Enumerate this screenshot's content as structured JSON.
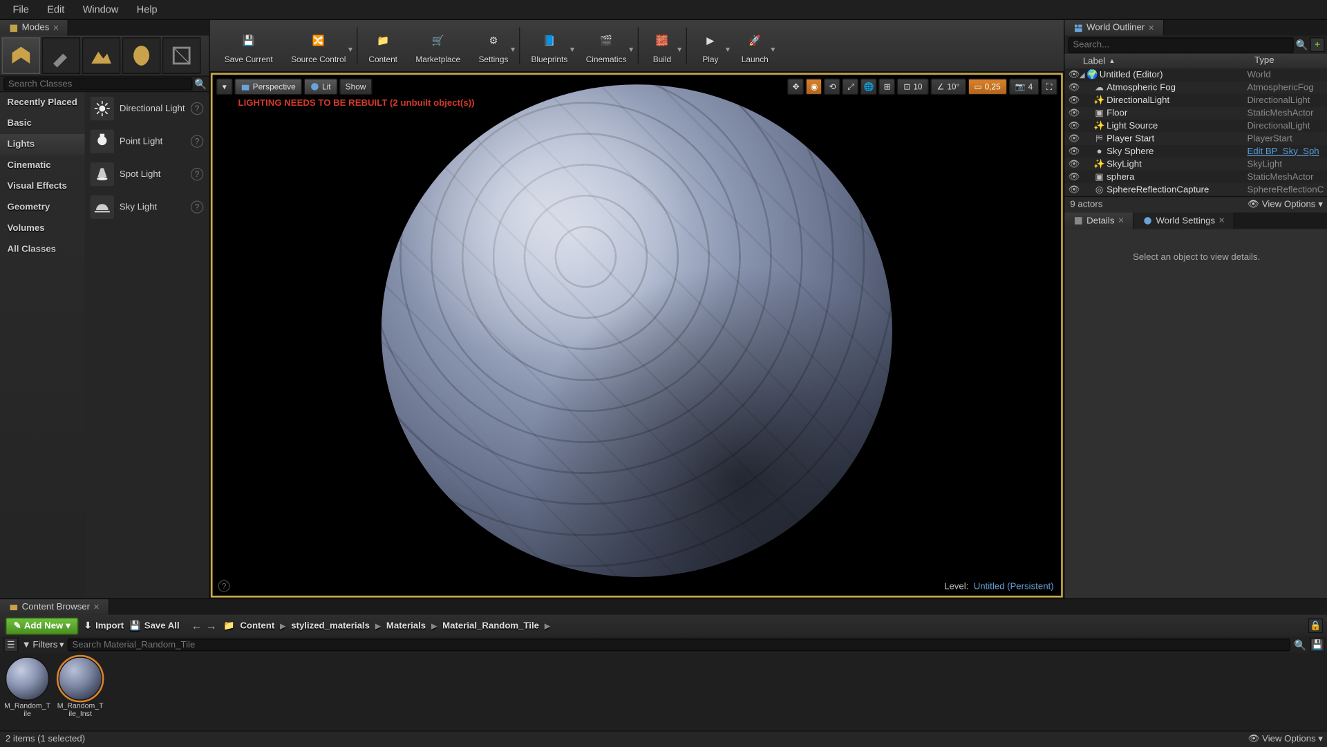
{
  "menu": {
    "file": "File",
    "edit": "Edit",
    "window": "Window",
    "help": "Help"
  },
  "modes_tab": "Modes",
  "searchClassesPlaceholder": "Search Classes",
  "categories": [
    "Recently Placed",
    "Basic",
    "Lights",
    "Cinematic",
    "Visual Effects",
    "Geometry",
    "Volumes",
    "All Classes"
  ],
  "activeCategory": "Lights",
  "lightItems": [
    {
      "label": "Directional Light"
    },
    {
      "label": "Point Light"
    },
    {
      "label": "Spot Light"
    },
    {
      "label": "Sky Light"
    }
  ],
  "toolbar": [
    {
      "label": "Save Current",
      "drop": false
    },
    {
      "label": "Source Control",
      "drop": true
    },
    {
      "label": "Content",
      "drop": false,
      "sep": true
    },
    {
      "label": "Marketplace",
      "drop": false
    },
    {
      "label": "Settings",
      "drop": true
    },
    {
      "label": "Blueprints",
      "drop": true,
      "sep": true
    },
    {
      "label": "Cinematics",
      "drop": true
    },
    {
      "label": "Build",
      "drop": true,
      "sep": true
    },
    {
      "label": "Play",
      "drop": true,
      "sep": true
    },
    {
      "label": "Launch",
      "drop": true
    }
  ],
  "viewport": {
    "perspective": "Perspective",
    "lit": "Lit",
    "show": "Show",
    "warning": "LIGHTING NEEDS TO BE REBUILT (2 unbuilt object(s))",
    "snap1": "10",
    "angle": "10°",
    "scale": "0,25",
    "cam": "4",
    "levelLabel": "Level:",
    "levelName": "Untitled (Persistent)"
  },
  "outliner": {
    "tab": "World Outliner",
    "searchPlaceholder": "Search...",
    "labelHdr": "Label",
    "typeHdr": "Type",
    "rows": [
      {
        "indent": 0,
        "label": "Untitled (Editor)",
        "type": "World",
        "icon": "world",
        "expand": true
      },
      {
        "indent": 1,
        "label": "Atmospheric Fog",
        "type": "AtmosphericFog",
        "icon": "fog"
      },
      {
        "indent": 1,
        "label": "DirectionalLight",
        "type": "DirectionalLight",
        "icon": "light"
      },
      {
        "indent": 1,
        "label": "Floor",
        "type": "StaticMeshActor",
        "icon": "mesh"
      },
      {
        "indent": 1,
        "label": "Light Source",
        "type": "DirectionalLight",
        "icon": "light"
      },
      {
        "indent": 1,
        "label": "Player Start",
        "type": "PlayerStart",
        "icon": "player"
      },
      {
        "indent": 1,
        "label": "Sky Sphere",
        "type": "Edit BP_Sky_Sph",
        "icon": "sphere",
        "link": true
      },
      {
        "indent": 1,
        "label": "SkyLight",
        "type": "SkyLight",
        "icon": "light"
      },
      {
        "indent": 1,
        "label": "sphera",
        "type": "StaticMeshActor",
        "icon": "mesh"
      },
      {
        "indent": 1,
        "label": "SphereReflectionCapture",
        "type": "SphereReflectionC",
        "icon": "reflect"
      }
    ],
    "actorCount": "9 actors",
    "viewOptions": "View Options"
  },
  "details": {
    "tab1": "Details",
    "tab2": "World Settings",
    "empty": "Select an object to view details."
  },
  "cb": {
    "tab": "Content Browser",
    "addNew": "Add New",
    "import": "Import",
    "saveAll": "Save All",
    "crumbs": [
      "Content",
      "stylized_materials",
      "Materials",
      "Material_Random_Tile"
    ],
    "filters": "Filters",
    "searchPlaceholder": "Search Material_Random_Tile",
    "assets": [
      {
        "label": "M_Random_Tile",
        "selected": false
      },
      {
        "label": "M_Random_Tile_Inst",
        "selected": true
      }
    ],
    "status": "2 items (1 selected)",
    "viewOptions": "View Options"
  }
}
